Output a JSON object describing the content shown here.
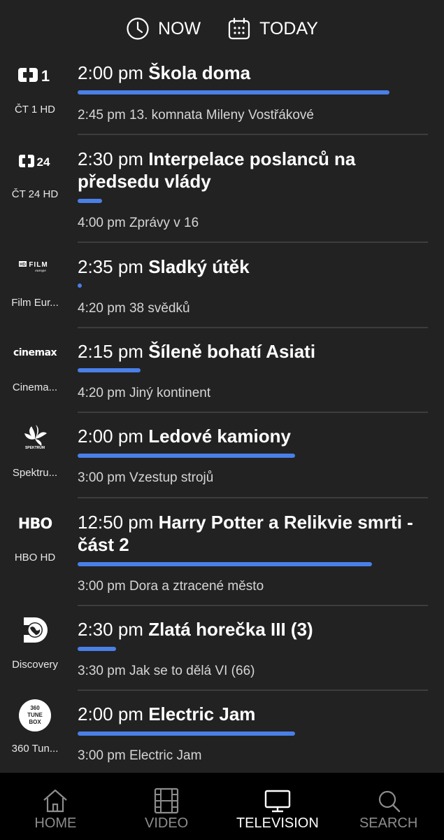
{
  "top": {
    "now_label": "NOW",
    "today_label": "TODAY"
  },
  "colors": {
    "background": "#222222",
    "progress": "#4a7fe8",
    "nav_bg": "#000000"
  },
  "channels": [
    {
      "logo": "ct1-logo",
      "name": "ČT 1 HD",
      "now_time": "2:00 pm",
      "now_title": "Škola doma",
      "progress": 0.89,
      "next_time": "2:45 pm",
      "next_title": "13. komnata Mileny Vostřákové"
    },
    {
      "logo": "ct24-logo",
      "name": "ČT 24 HD",
      "now_time": "2:30 pm",
      "now_title": "Interpelace poslanců na předsedu vlády",
      "progress": 0.07,
      "next_time": "4:00 pm",
      "next_title": "Zprávy v 16"
    },
    {
      "logo": "film-europe-logo",
      "name": "Film Eur...",
      "now_time": "2:35 pm",
      "now_title": "Sladký útěk",
      "progress": 0.01,
      "next_time": "4:20 pm",
      "next_title": "38 svědků"
    },
    {
      "logo": "cinemax-logo",
      "name": "Cinema...",
      "now_time": "2:15 pm",
      "now_title": "Šíleně bohatí Asiati",
      "progress": 0.18,
      "next_time": "4:20 pm",
      "next_title": "Jiný kontinent"
    },
    {
      "logo": "spektrum-logo",
      "name": "Spektru...",
      "now_time": "2:00 pm",
      "now_title": "Ledové kamiony",
      "progress": 0.62,
      "next_time": "3:00 pm",
      "next_title": "Vzestup strojů"
    },
    {
      "logo": "hbo-logo",
      "name": "HBO HD",
      "now_time": "12:50 pm",
      "now_title": "Harry Potter a Relikvie smrti - část 2",
      "progress": 0.84,
      "next_time": "3:00 pm",
      "next_title": "Dora a ztracené město"
    },
    {
      "logo": "discovery-logo",
      "name": "Discovery",
      "now_time": "2:30 pm",
      "now_title": "Zlatá horečka III (3)",
      "progress": 0.11,
      "next_time": "3:30 pm",
      "next_title": "Jak se to dělá VI (66)"
    },
    {
      "logo": "360-tunebox-logo",
      "name": "360 Tun...",
      "now_time": "2:00 pm",
      "now_title": "Electric Jam",
      "progress": 0.62,
      "next_time": "3:00 pm",
      "next_title": "Electric Jam"
    }
  ],
  "logo_texts": {
    "ct1": "1",
    "ct24": "24",
    "film_hd": "HD",
    "film_film": "FILM",
    "film_europe": "europe",
    "cinemax": "cinemax",
    "spektrum": "SPEKTRUM",
    "hbo": "HBO",
    "tunebox_1": "360",
    "tunebox_2": "TUNE",
    "tunebox_3": "BOX"
  },
  "nav": {
    "home": "HOME",
    "video": "VIDEO",
    "television": "TELEVISION",
    "search": "SEARCH",
    "active": "television"
  }
}
